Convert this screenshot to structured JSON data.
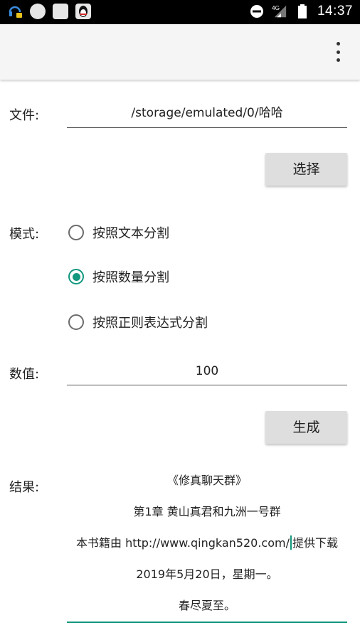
{
  "status_bar": {
    "time": "14:37",
    "network": "4G",
    "icons": [
      "headset-notification-icon",
      "notification-circle-icon",
      "notification-square-icon",
      "qq-icon",
      "do-not-disturb-icon",
      "signal-icon",
      "battery-icon"
    ]
  },
  "app_bar": {
    "menu_icon": "overflow-menu-icon"
  },
  "file": {
    "label": "文件:",
    "value": "/storage/emulated/0/哈哈",
    "select_button": "选择"
  },
  "mode": {
    "label": "模式:",
    "options": [
      {
        "label": "按照文本分割",
        "selected": false
      },
      {
        "label": "按照数量分割",
        "selected": true
      },
      {
        "label": "按照正则表达式分割",
        "selected": false
      }
    ]
  },
  "value_field": {
    "label": "数值:",
    "value": "100",
    "generate_button": "生成"
  },
  "result": {
    "label": "结果:",
    "lines": [
      "《修真聊天群》",
      "第1章 黄山真君和九洲一号群",
      "本书籍由 http://www.qingkan520.com/",
      "2019年5月20日，星期一。",
      "春尽夏至。"
    ],
    "line3_after_cursor": "提供下载"
  },
  "colors": {
    "accent": "#12987e",
    "button": "#dedede",
    "appbar": "#f5f5f5"
  }
}
